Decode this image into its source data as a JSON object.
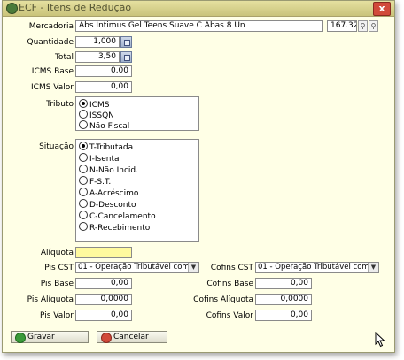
{
  "window": {
    "title": "ECF - Itens de Redução",
    "close_label": "x"
  },
  "mercadoria": {
    "label": "Mercadoria",
    "value": "Abs Intimus Gel Teens Suave C Abas 8 Un",
    "code": "167.329"
  },
  "quantidade": {
    "label": "Quantidade",
    "value": "1,000"
  },
  "total": {
    "label": "Total",
    "value": "3,50"
  },
  "icms_base": {
    "label": "ICMS Base",
    "value": "0,00"
  },
  "icms_valor": {
    "label": "ICMS Valor",
    "value": "0,00"
  },
  "tributo": {
    "label": "Tributo",
    "options": [
      {
        "label": "ICMS",
        "selected": true
      },
      {
        "label": "ISSQN",
        "selected": false
      },
      {
        "label": "Não Fiscal",
        "selected": false
      }
    ]
  },
  "situacao": {
    "label": "Situação",
    "options": [
      {
        "label": "T-Tributada",
        "selected": true
      },
      {
        "label": "I-Isenta",
        "selected": false
      },
      {
        "label": "N-Não Incid.",
        "selected": false
      },
      {
        "label": "F-S.T.",
        "selected": false
      },
      {
        "label": "A-Acréscimo",
        "selected": false
      },
      {
        "label": "D-Desconto",
        "selected": false
      },
      {
        "label": "C-Cancelamento",
        "selected": false
      },
      {
        "label": "R-Recebimento",
        "selected": false
      }
    ]
  },
  "aliquota": {
    "label": "Alíquota",
    "value": ""
  },
  "pis": {
    "cst_label": "Pis CST",
    "cst_value": "01 - Operação Tributável com Alíqu",
    "base_label": "Pis Base",
    "base_value": "0,00",
    "aliquota_label": "Pis Alíquota",
    "aliquota_value": "0,0000",
    "valor_label": "Pis Valor",
    "valor_value": "0,00"
  },
  "cofins": {
    "cst_label": "Cofins CST",
    "cst_value": "01 - Operação Tributável com Alíqu",
    "base_label": "Cofins Base",
    "base_value": "0,00",
    "aliquota_label": "Cofins Alíquota",
    "aliquota_value": "0,0000",
    "valor_label": "Cofins Valor",
    "valor_value": "0,00"
  },
  "buttons": {
    "gravar": "Gravar",
    "cancelar": "Cancelar"
  },
  "colors": {
    "window_bg": "#ffffe6",
    "title_bar": "#d6d08a",
    "close": "#d14a3a",
    "aliquota_bg": "#fffa9e"
  }
}
